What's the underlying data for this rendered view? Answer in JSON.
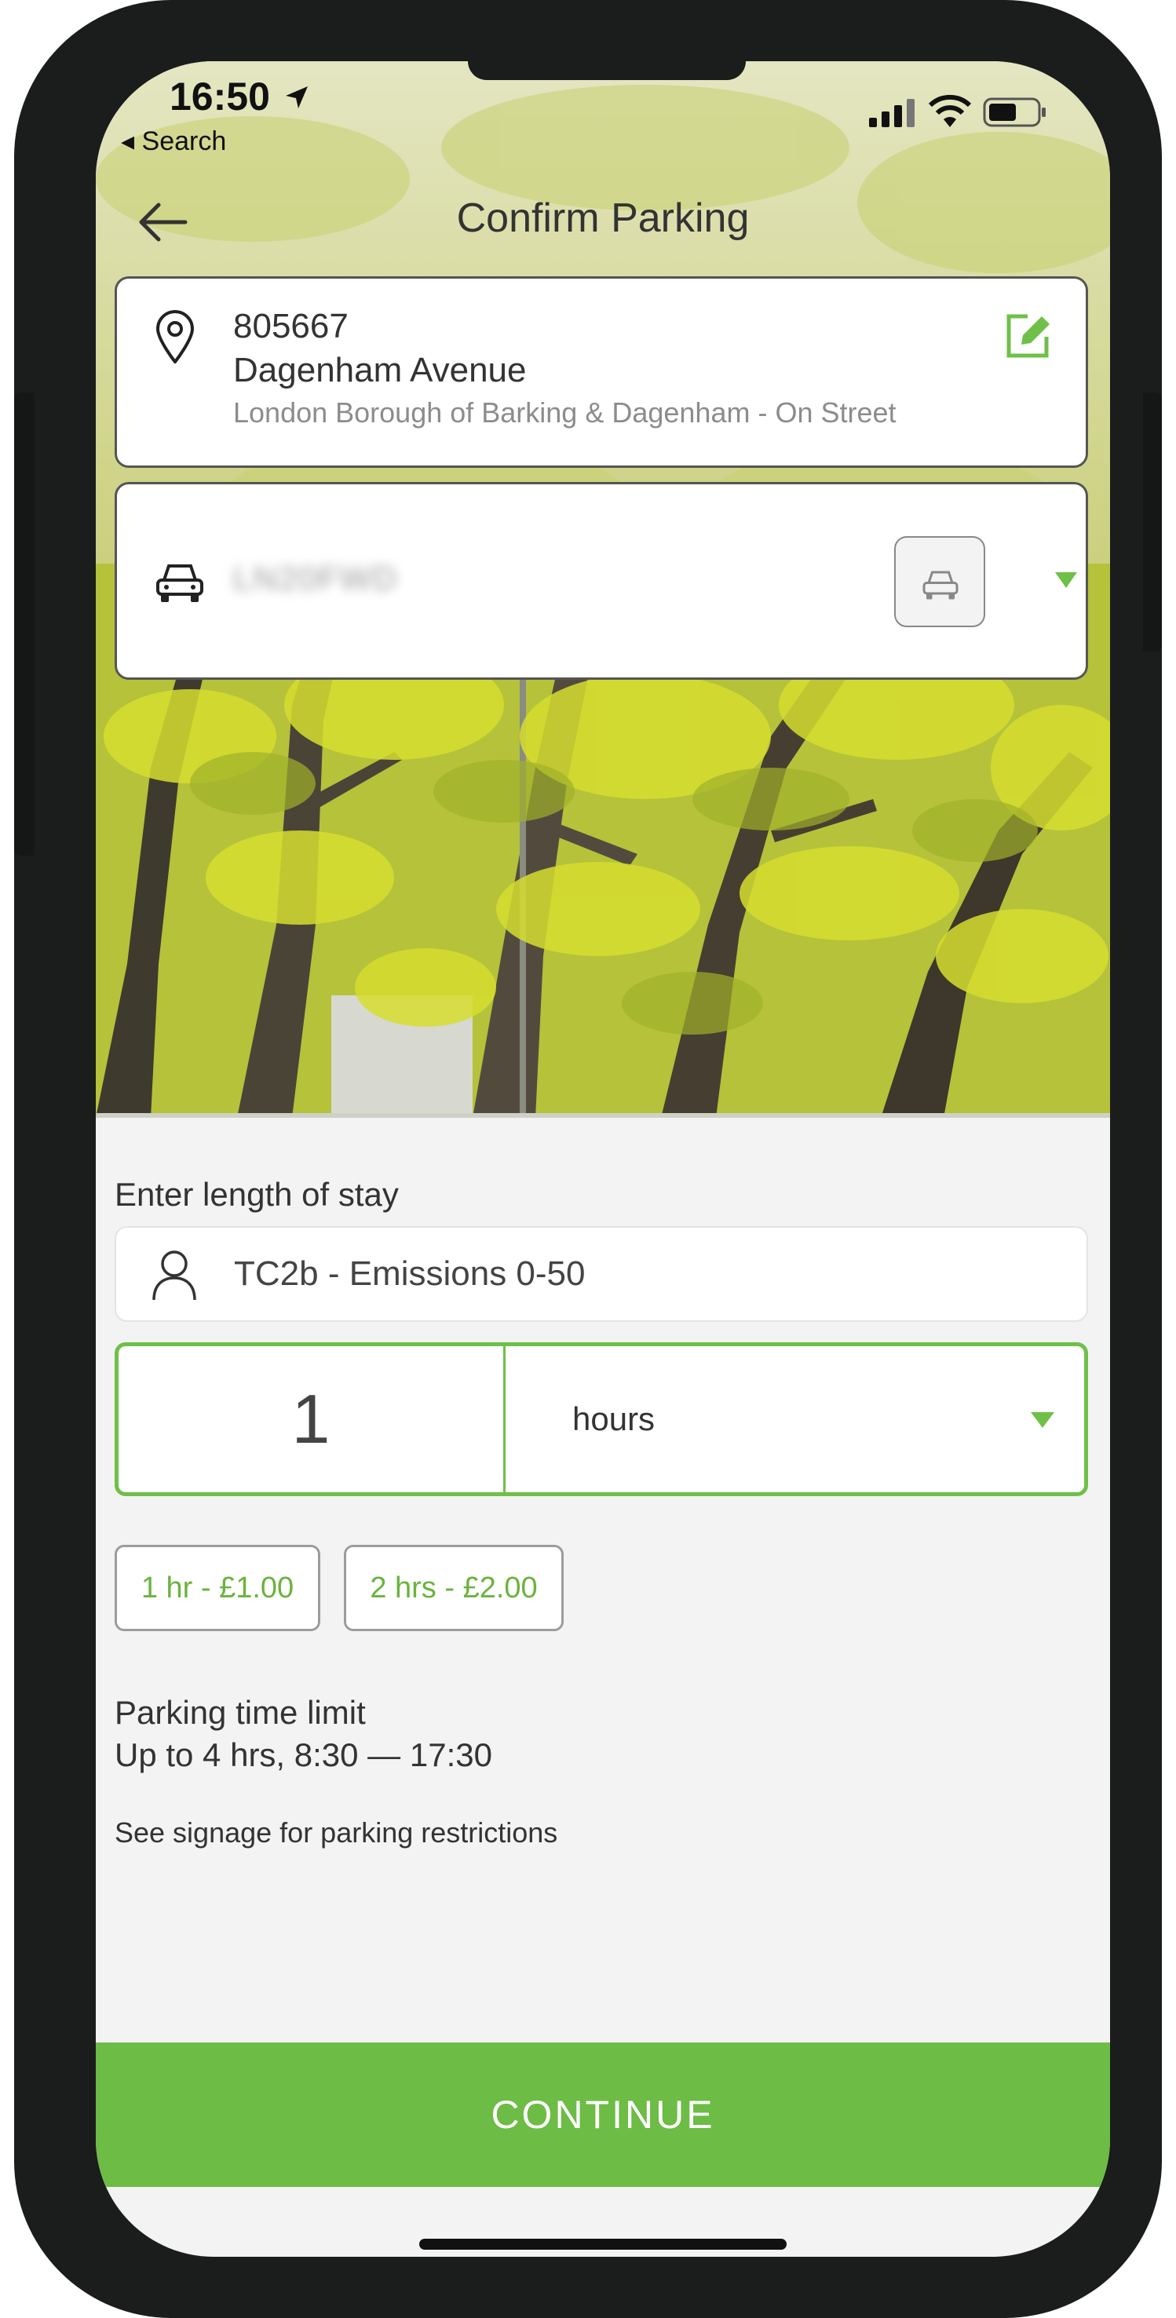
{
  "status_bar": {
    "time": "16:50",
    "back_app": "Search"
  },
  "nav": {
    "title": "Confirm Parking"
  },
  "location": {
    "code": "805667",
    "street": "Dagenham Avenue",
    "area": "London Borough of Barking & Dagenham - On Street"
  },
  "vehicle": {
    "plate": "LN20FWD"
  },
  "stay": {
    "label": "Enter length of stay",
    "tariff": "TC2b - Emissions 0-50",
    "duration_value": "1",
    "duration_unit": "hours",
    "quick_options": [
      "1 hr - £1.00",
      "2 hrs - £2.00"
    ]
  },
  "limits": {
    "title": "Parking time limit",
    "value": "Up to 4 hrs, 8:30 — 17:30",
    "note": "See signage for parking restrictions"
  },
  "actions": {
    "continue_label": "CONTINUE"
  },
  "colors": {
    "accent": "#6dbc45",
    "border": "#555555",
    "background": "#f3f3f3"
  },
  "icons": [
    "location-arrow-icon",
    "signal-icon",
    "wifi-icon",
    "battery-icon",
    "back-arrow-icon",
    "map-pin-icon",
    "edit-icon",
    "car-icon",
    "person-icon",
    "chevron-down-icon"
  ]
}
